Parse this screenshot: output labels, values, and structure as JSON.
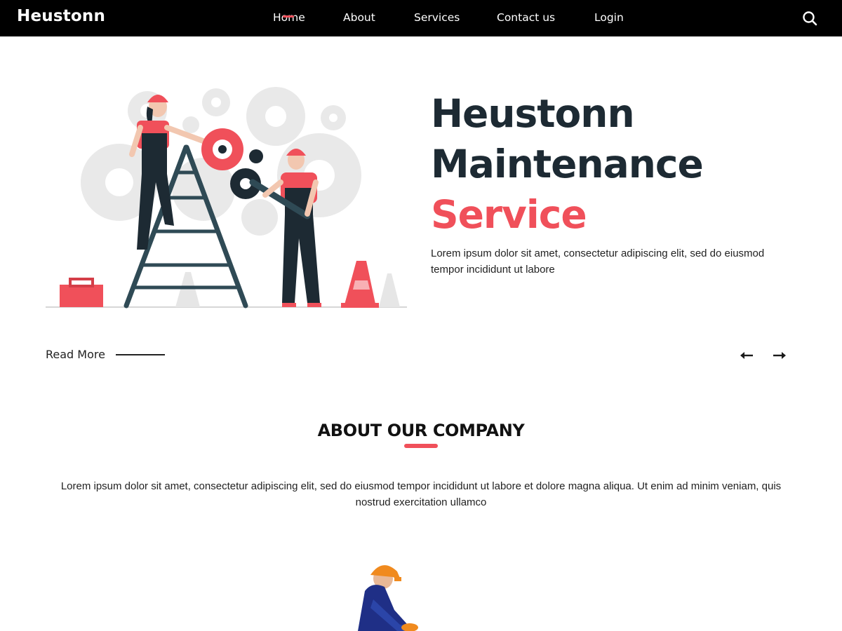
{
  "navbar": {
    "brand": "Heustonn",
    "items": [
      {
        "label": "Home",
        "active": true
      },
      {
        "label": "About",
        "active": false
      },
      {
        "label": "Services",
        "active": false
      },
      {
        "label": "Contact us",
        "active": false
      },
      {
        "label": "Login",
        "active": false
      }
    ],
    "search_icon": "search-icon"
  },
  "hero": {
    "title_line1": "Heustonn",
    "title_line2": "Maintenance",
    "title_accent": "Service",
    "text": "Lorem ipsum dolor sit amet, consectetur adipiscing elit, sed do eiusmod tempor incididunt ut labore",
    "read_more": "Read More",
    "prev_icon": "arrow-left-icon",
    "next_icon": "arrow-right-icon"
  },
  "about": {
    "heading": "ABOUT OUR COMPANY",
    "text": "Lorem ipsum dolor sit amet, consectetur adipiscing elit, sed do eiusmod tempor incididunt ut labore et dolore magna aliqua. Ut enim ad minim veniam, quis nostrud exercitation ullamco"
  },
  "colors": {
    "accent": "#f0505a",
    "heading_dark": "#1d2a33",
    "navbar_bg": "#000000"
  }
}
